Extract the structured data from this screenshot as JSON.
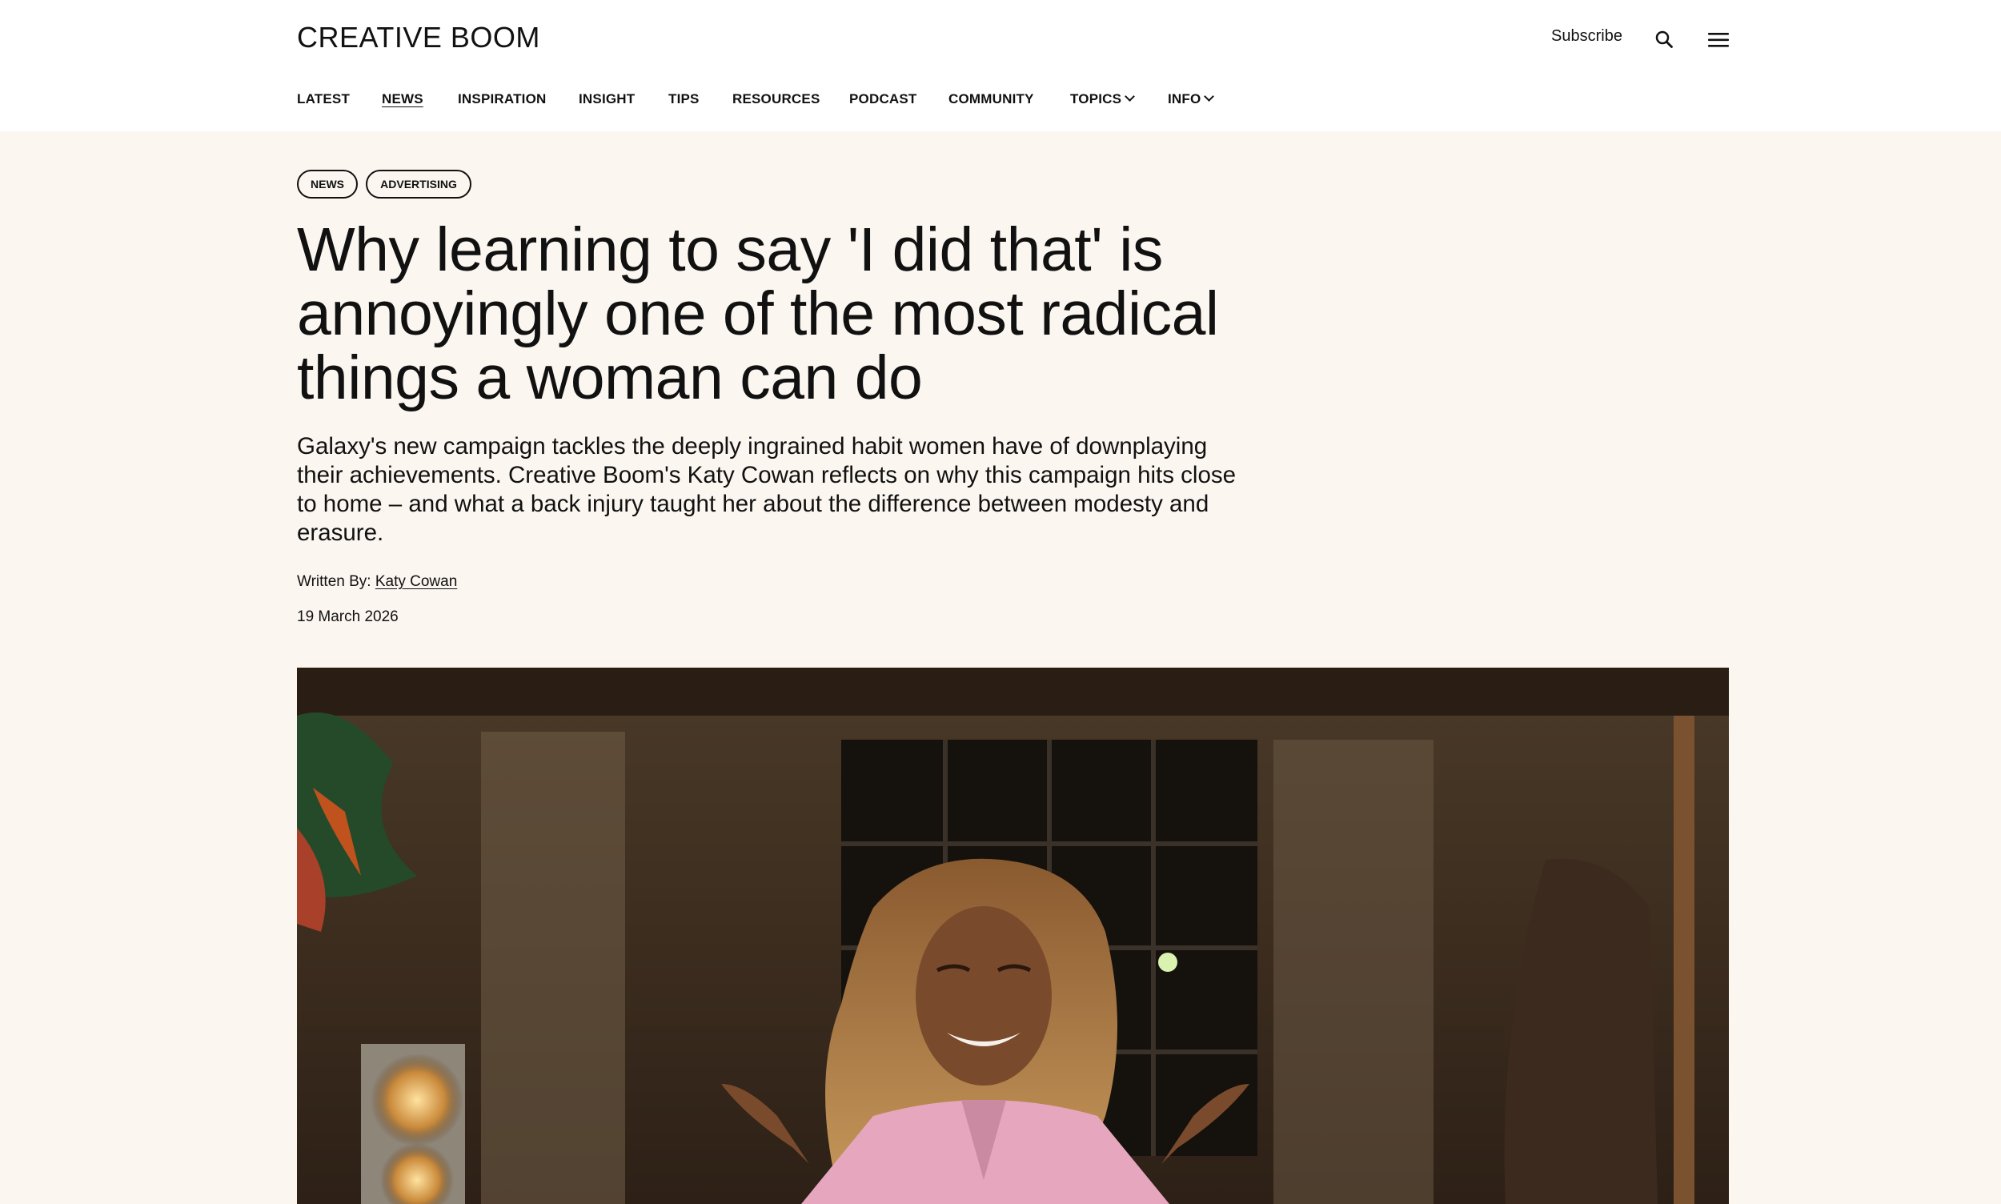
{
  "site": {
    "logo": "CREATIVE BOOM",
    "subscribe_label": "Subscribe"
  },
  "nav": {
    "items": [
      {
        "label": "LATEST"
      },
      {
        "label": "NEWS"
      },
      {
        "label": "INSPIRATION"
      },
      {
        "label": "INSIGHT"
      },
      {
        "label": "TIPS"
      },
      {
        "label": "RESOURCES"
      },
      {
        "label": "PODCAST"
      },
      {
        "label": "COMMUNITY"
      },
      {
        "label": "TOPICS"
      },
      {
        "label": "INFO"
      }
    ],
    "active": "NEWS"
  },
  "article": {
    "tags": [
      "NEWS",
      "ADVERTISING"
    ],
    "headline_lines": [
      "Why learning to say 'I did that' is",
      "annoyingly one of the most radical",
      "things a woman can do"
    ],
    "standfirst_lines": [
      "Galaxy's new campaign tackles the deeply ingrained habit women have of downplaying",
      "their achievements. Creative Boom's Katy Cowan reflects on why this campaign hits close",
      "to home – and what a back injury taught her about the difference between modesty and",
      "erasure."
    ],
    "byline_prefix": "Written By: ",
    "author": "Katy Cowan",
    "date": "19 March 2026"
  },
  "icons": {
    "search": "search-icon",
    "menu": "hamburger-menu-icon",
    "dropdown": "chevron-down-icon"
  },
  "colors": {
    "page_background": "#fbf6f0",
    "header_background": "#ffffff",
    "text": "#111111",
    "blazer_pink": "#e6a7be"
  }
}
